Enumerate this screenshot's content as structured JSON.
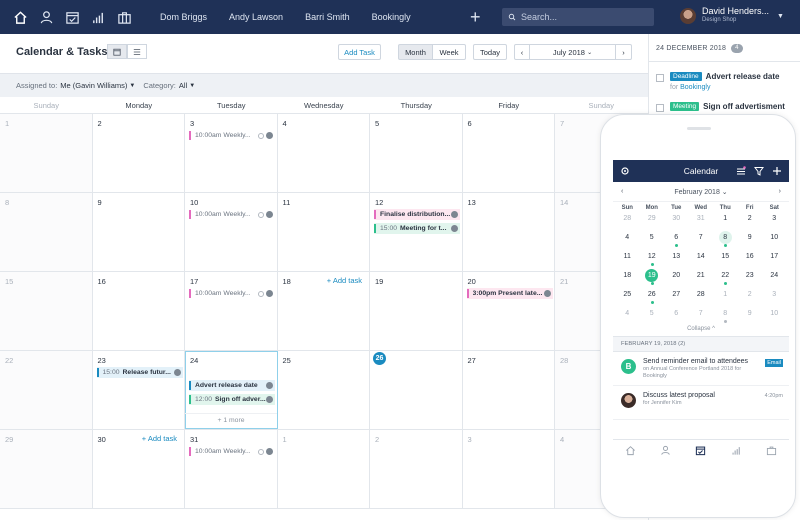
{
  "nav": {
    "icons": [
      "home-icon",
      "person-icon",
      "calendar-check-icon",
      "bar-chart-icon",
      "briefcase-icon"
    ],
    "links": [
      "Dom Briggs",
      "Andy Lawson",
      "Barri Smith",
      "Bookingly"
    ],
    "search_placeholder": "Search...",
    "user": {
      "name": "David Henders...",
      "subtitle": "Design Shop"
    }
  },
  "toolbar": {
    "title": "Calendar & Tasks",
    "add_task": "Add Task",
    "month": "Month",
    "week": "Week",
    "today": "Today",
    "current_month": "July 2018"
  },
  "filter": {
    "assigned_label": "Assigned to:",
    "assigned_value": "Me (Gavin Williams)",
    "category_label": "Category:",
    "category_value": "All"
  },
  "weekdays": [
    "Sunday",
    "Monday",
    "Tuesday",
    "Wednesday",
    "Thursday",
    "Friday",
    "Sunday"
  ],
  "weeks": [
    [
      "1",
      "2",
      "3",
      "4",
      "5",
      "6",
      "7"
    ],
    [
      "8",
      "9",
      "10",
      "11",
      "12",
      "13",
      "14"
    ],
    [
      "15",
      "16",
      "17",
      "18",
      "19",
      "20",
      "21"
    ],
    [
      "22",
      "23",
      "24",
      "25",
      "26",
      "27",
      "28"
    ],
    [
      "29",
      "30",
      "31",
      "1",
      "2",
      "3",
      "4"
    ]
  ],
  "add_task_link": "+ Add task",
  "more_link": "+ 1 more",
  "events": {
    "w0_tue": "10:00am Weekly...",
    "w1_tue": "10:00am Weekly...",
    "w1_thu_1": "Finalise distribution...",
    "w1_thu_2_time": "15:00",
    "w1_thu_2": "Meeting for t...",
    "w2_tue": "10:00am Weekly...",
    "w2_fri": "3:00pm Present late...",
    "w3_mon_time": "15:00",
    "w3_mon": "Release futur...",
    "w3_tue_1": "Advert release date",
    "w3_tue_2_time": "12:00",
    "w3_tue_2": "Sign off adver...",
    "w4_tue": "10:00am Weekly..."
  },
  "colors": {
    "accent": "#1a8bc0",
    "nav": "#1f3157",
    "pink": "#e46bbe",
    "green": "#2cbf8c",
    "blue": "#1a8bc0"
  },
  "panel": {
    "date": "24 DECEMBER 2018",
    "count": "4",
    "items": [
      {
        "tag": "Deadline",
        "title": "Advert release date",
        "for_label": "for",
        "for_value": "Bookingly"
      },
      {
        "tag": "Meeting",
        "title": "Sign off advertisment"
      }
    ]
  },
  "phone": {
    "title": "Calendar",
    "month": "February 2018",
    "dow": [
      "Sun",
      "Mon",
      "Tue",
      "Wed",
      "Thu",
      "Fri",
      "Sat"
    ],
    "rows": [
      [
        "28",
        "29",
        "30",
        "31",
        "1",
        "2",
        "3"
      ],
      [
        "4",
        "5",
        "6",
        "7",
        "8",
        "9",
        "10"
      ],
      [
        "11",
        "12",
        "13",
        "14",
        "15",
        "16",
        "17"
      ],
      [
        "18",
        "19",
        "20",
        "21",
        "22",
        "23",
        "24"
      ],
      [
        "25",
        "26",
        "27",
        "28",
        "1",
        "2",
        "3"
      ],
      [
        "4",
        "5",
        "6",
        "7",
        "8",
        "9",
        "10"
      ]
    ],
    "collapse": "Collapse ^",
    "section": "FEBRUARY 19, 2018 (2)",
    "items": [
      {
        "initial": "B",
        "title": "Send reminder email to attendees",
        "sub_prefix": "on",
        "sub_value": "Annual Conference Portland 2018 for Bookingly",
        "tag": "Email"
      },
      {
        "title": "Discuss latest proposal",
        "sub_prefix": "for",
        "sub_value": "Jennifer Kim",
        "time": "4:20pm"
      }
    ]
  }
}
